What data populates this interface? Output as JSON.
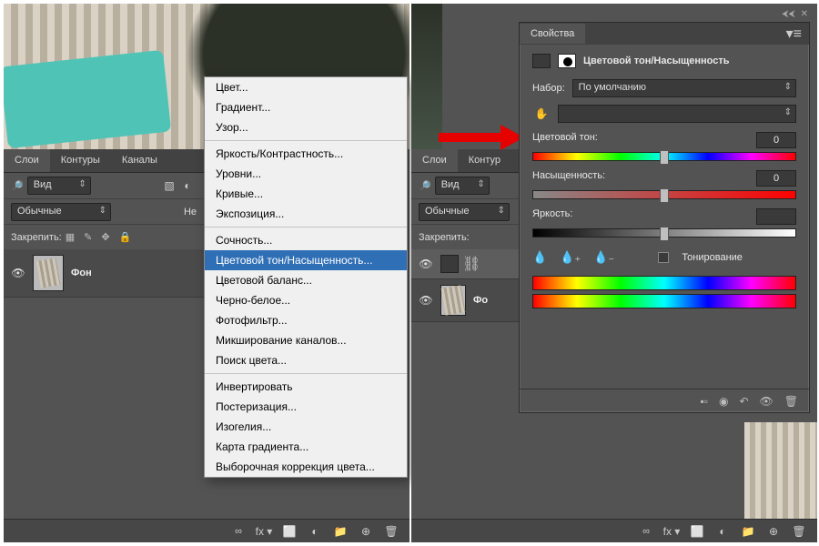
{
  "left": {
    "tabs": [
      "Слои",
      "Контуры",
      "Каналы"
    ],
    "filter_label": "Вид",
    "blend_mode": "Обычные",
    "opacity_label_stub": "Не",
    "lock_label": "Закрепить:",
    "layer_name": "Фон",
    "bottom_icons": [
      "∞",
      "fx ▾",
      "⬜",
      "◐",
      "📁",
      "⊕",
      "🗑"
    ]
  },
  "context_menu": {
    "groups": [
      [
        "Цвет...",
        "Градиент...",
        "Узор..."
      ],
      [
        "Яркость/Контрастность...",
        "Уровни...",
        "Кривые...",
        "Экспозиция..."
      ],
      [
        "Сочность...",
        "Цветовой тон/Насыщенность...",
        "Цветовой баланс...",
        "Черно-белое...",
        "Фотофильтр...",
        "Микширование каналов...",
        "Поиск цвета..."
      ],
      [
        "Инвертировать",
        "Постеризация...",
        "Изогелия...",
        "Карта градиента...",
        "Выборочная коррекция цвета..."
      ]
    ],
    "highlighted": "Цветовой тон/Насыщенность..."
  },
  "right": {
    "tabs": [
      "Слои",
      "Контур"
    ],
    "filter_label": "Вид",
    "blend_mode": "Обычные",
    "lock_label": "Закрепить:",
    "layer_top_trunc": "",
    "layer_name": "Фо",
    "bottom_icons": [
      "∞",
      "fx ▾",
      "⬜",
      "◐",
      "📁",
      "⊕",
      "🗑"
    ]
  },
  "properties": {
    "tab": "Свойства",
    "title": "Цветовой тон/Насыщенность",
    "preset_label": "Набор:",
    "preset_value": "По умолчанию",
    "range_value": "",
    "hue_label": "Цветовой тон:",
    "hue_value": "0",
    "sat_label": "Насыщенность:",
    "sat_value": "0",
    "lig_label": "Яркость:",
    "lig_value": "",
    "colorize_label": "Тонирование",
    "bottom_icons": [
      "▪▫",
      "◉",
      "↶",
      "👁",
      "🗑"
    ]
  }
}
